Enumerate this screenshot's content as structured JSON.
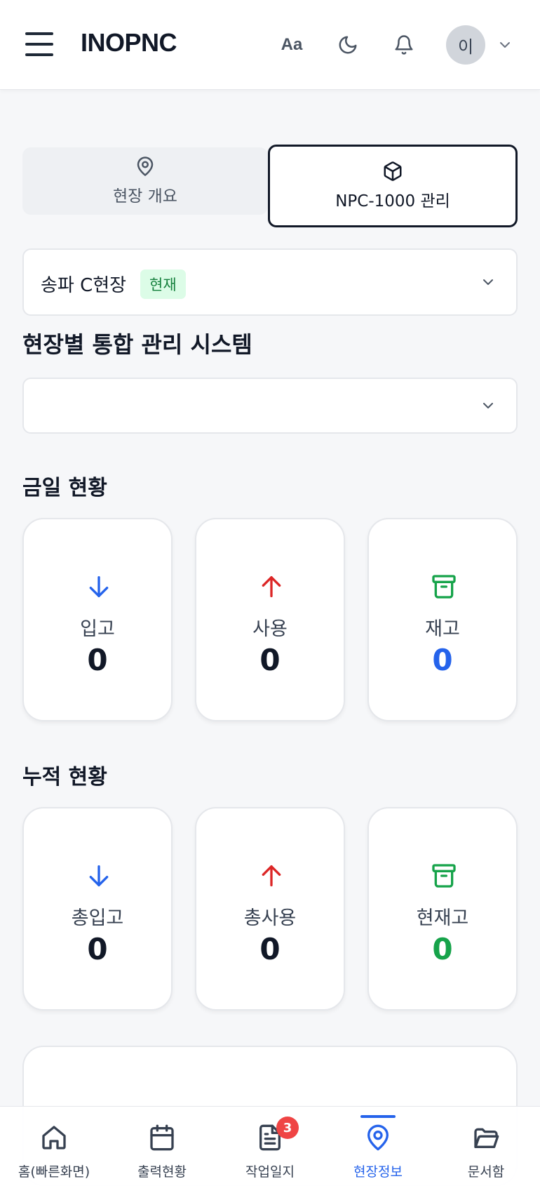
{
  "header": {
    "logo": "INOPNC",
    "font_toggle": "Aa",
    "avatar_initial": "이"
  },
  "tabs": [
    {
      "label": "현장 개요",
      "icon": "map-pin-icon",
      "active": false
    },
    {
      "label": "NPC-1000 관리",
      "icon": "box-icon",
      "active": true
    }
  ],
  "site_select": {
    "name": "송파 C현장",
    "badge": "현재",
    "badge_color": "#15803d"
  },
  "system_title": "현장별 통합 관리 시스템",
  "empty_select_value": "",
  "today": {
    "title": "금일 현황",
    "cards": [
      {
        "label": "입고",
        "value": "0",
        "icon": "arrow-down-icon",
        "color": "#2563eb"
      },
      {
        "label": "사용",
        "value": "0",
        "icon": "arrow-up-icon",
        "color": "#dc2626"
      },
      {
        "label": "재고",
        "value": "0",
        "icon": "archive-icon",
        "color": "#16a34a",
        "value_color": "#2563eb"
      }
    ]
  },
  "cumulative": {
    "title": "누적 현황",
    "cards": [
      {
        "label": "총입고",
        "value": "0",
        "icon": "arrow-down-icon",
        "color": "#2563eb"
      },
      {
        "label": "총사용",
        "value": "0",
        "icon": "arrow-up-icon",
        "color": "#dc2626"
      },
      {
        "label": "현재고",
        "value": "0",
        "icon": "archive-icon",
        "color": "#16a34a",
        "value_color": "#16a34a"
      }
    ]
  },
  "bottom_nav": [
    {
      "label": "홈(빠른화면)",
      "icon": "home-icon",
      "active": false
    },
    {
      "label": "출력현황",
      "icon": "calendar-icon",
      "active": false
    },
    {
      "label": "작업일지",
      "icon": "document-icon",
      "active": false,
      "badge": "3"
    },
    {
      "label": "현장정보",
      "icon": "map-pin-icon",
      "active": true
    },
    {
      "label": "문서함",
      "icon": "folder-icon",
      "active": false
    }
  ]
}
